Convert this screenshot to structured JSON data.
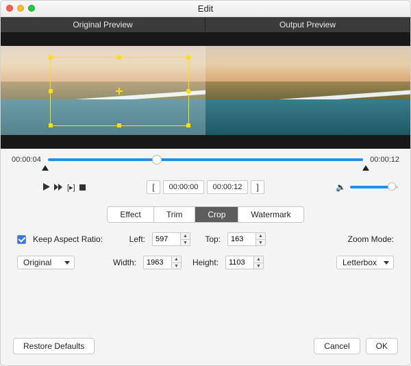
{
  "window": {
    "title": "Edit"
  },
  "preview": {
    "original_label": "Original Preview",
    "output_label": "Output Preview"
  },
  "timeline": {
    "current": "00:00:04",
    "duration": "00:00:12",
    "in_time": "00:00:00",
    "out_time": "00:00:12",
    "playhead_percent": 33
  },
  "tabs": {
    "effect": "Effect",
    "trim": "Trim",
    "crop": "Crop",
    "watermark": "Watermark",
    "active": "crop"
  },
  "crop": {
    "keep_aspect_label": "Keep Aspect Ratio:",
    "keep_aspect_checked": true,
    "left_label": "Left:",
    "left_value": "597",
    "top_label": "Top:",
    "top_value": "163",
    "width_label": "Width:",
    "width_value": "1963",
    "height_label": "Height:",
    "height_value": "1103",
    "zoom_mode_label": "Zoom Mode:",
    "aspect_preset": "Original",
    "zoom_mode_value": "Letterbox"
  },
  "footer": {
    "restore": "Restore Defaults",
    "cancel": "Cancel",
    "ok": "OK"
  },
  "icons": {
    "play": "▶",
    "ff": "⏩",
    "step": "⏭",
    "stop": "■",
    "speaker": "🔈"
  }
}
